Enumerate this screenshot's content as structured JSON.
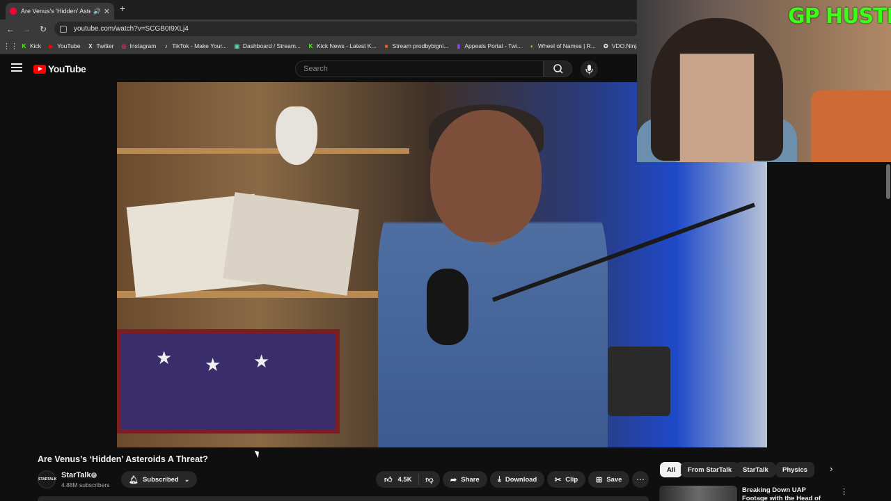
{
  "browser": {
    "tab_title": "Are Venus's 'Hidden' Asteroids",
    "url": "youtube.com/watch?v=SCGB0I9XLj4",
    "bookmarks": [
      {
        "label": "Kick",
        "color": "#53fc18",
        "glyph": "K"
      },
      {
        "label": "YouTube",
        "color": "#ff0000",
        "glyph": "▶"
      },
      {
        "label": "Twitter",
        "color": "#e6e6e6",
        "glyph": "X"
      },
      {
        "label": "Instagram",
        "color": "#e1306c",
        "glyph": "◎"
      },
      {
        "label": "TikTok - Make Your...",
        "color": "#ffffff",
        "glyph": "♪"
      },
      {
        "label": "Dashboard / Stream...",
        "color": "#4bd4b0",
        "glyph": "▣"
      },
      {
        "label": "Kick News - Latest K...",
        "color": "#53fc18",
        "glyph": "K"
      },
      {
        "label": "Stream prodbybigni...",
        "color": "#ff5a1f",
        "glyph": "■"
      },
      {
        "label": "Appeals Portal - Twi...",
        "color": "#9146ff",
        "glyph": "▮"
      },
      {
        "label": "Wheel of Names | R...",
        "color": "#f5c518",
        "glyph": "◐"
      },
      {
        "label": "VDO.Ninja",
        "color": "#dddddd",
        "glyph": "✪"
      }
    ]
  },
  "youtube": {
    "logo": "YouTube",
    "search_placeholder": "Search",
    "video": {
      "title": "Are Venus’s ‘Hidden’ Asteroids A Threat?",
      "channel": "StarTalk",
      "channel_avatar_text": "STARTALK",
      "subscribers": "4.88M subscribers",
      "subscribed_label": "Subscribed",
      "likes": "4.5K",
      "share_label": "Share",
      "download_label": "Download",
      "clip_label": "Clip",
      "save_label": "Save"
    },
    "chips": [
      "All",
      "From StarTalk",
      "StarTalk",
      "Physics"
    ],
    "recommendation": {
      "title": "Breaking Down UAP Footage with the Head of The Pentagon"
    }
  },
  "overlay": {
    "label": "GP HUSTLA"
  }
}
